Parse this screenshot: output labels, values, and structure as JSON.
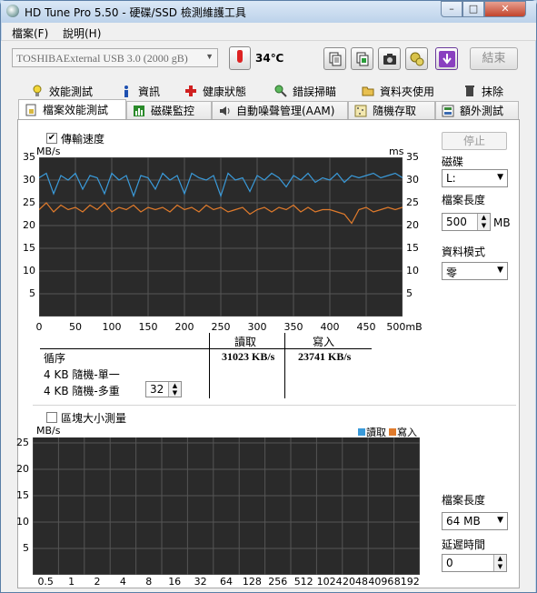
{
  "window": {
    "title": "HD Tune Pro 5.50 - 硬碟/SSD 檢測維護工具",
    "min": "–",
    "max": "□",
    "close": "✕"
  },
  "menu": [
    {
      "label": "檔案(F)"
    },
    {
      "label": "說明(H)"
    }
  ],
  "toolbar": {
    "drive": "TOSHIBAExternal USB 3.0 (2000 gB)",
    "temperature": "34℃",
    "exit_label": "結束",
    "icons": [
      "copy-text-icon",
      "copy-screenshot-icon",
      "camera-icon",
      "options-icon",
      "save-icon"
    ]
  },
  "tabs_row1": [
    {
      "label": "效能測試",
      "icon": "bulb-icon"
    },
    {
      "label": "資訊",
      "icon": "info-icon"
    },
    {
      "label": "健康狀態",
      "icon": "health-cross-icon"
    },
    {
      "label": "錯誤掃瞄",
      "icon": "magnifier-icon"
    },
    {
      "label": "資料夾使用",
      "icon": "folder-icon"
    },
    {
      "label": "抹除",
      "icon": "trash-icon"
    }
  ],
  "tabs_row2": [
    {
      "label": "檔案效能測試",
      "icon": "file-icon",
      "active": true
    },
    {
      "label": "磁碟監控",
      "icon": "monitor-icon"
    },
    {
      "label": "自動噪聲管理(AAM)",
      "icon": "speaker-icon"
    },
    {
      "label": "隨機存取",
      "icon": "random-icon"
    },
    {
      "label": "額外測試",
      "icon": "extra-icon"
    }
  ],
  "transfer": {
    "checkbox_label": "傳輸速度",
    "checked": true,
    "left_unit": "MB/s",
    "right_unit": "ms"
  },
  "side": {
    "stop_label": "停止",
    "disk_label": "磁碟",
    "disk_value": "L:",
    "file_length_label": "檔案長度",
    "file_length_value": "500",
    "file_length_unit": "MB",
    "data_pattern_label": "資料模式",
    "data_pattern_value": "零"
  },
  "results": {
    "col_read": "讀取",
    "col_write": "寫入",
    "rows": [
      {
        "label": "循序",
        "read": "31023 KB/s",
        "write": "23741 KB/s"
      },
      {
        "label": "4 KB 隨機-單一",
        "read": "",
        "write": ""
      },
      {
        "label": "4 KB 隨機-多重",
        "read": "",
        "write": "",
        "queue": "32"
      }
    ]
  },
  "block": {
    "checkbox_label": "區塊大小測量",
    "checked": false,
    "unit": "MB/s",
    "legend_read": "讀取",
    "legend_write": "寫入",
    "file_length_label": "檔案長度",
    "file_length_value": "64 MB",
    "delay_label": "延遲時間",
    "delay_value": "0"
  },
  "colors": {
    "read": "#3a9ad9",
    "write": "#e07b2c",
    "chart_bg": "#2a2a2a",
    "grid": "#555555"
  },
  "chart_data": [
    {
      "type": "line",
      "title": "",
      "xlabel": "",
      "ylabel": "MB/s",
      "x_unit": "MB",
      "xlim": [
        0,
        500
      ],
      "ylim": [
        0,
        35
      ],
      "xticks": [
        "0",
        "50",
        "100",
        "150",
        "200",
        "250",
        "300",
        "350",
        "400",
        "450",
        "500mB"
      ],
      "yticks_left": [
        "35",
        "30",
        "25",
        "20",
        "15",
        "10",
        "5"
      ],
      "yticks_right": [
        "35",
        "30",
        "25",
        "20",
        "15",
        "10",
        "5"
      ],
      "grid": true,
      "series": [
        {
          "name": "讀取",
          "x": [
            0,
            10,
            20,
            30,
            40,
            50,
            60,
            70,
            80,
            90,
            100,
            110,
            120,
            130,
            140,
            150,
            160,
            170,
            180,
            190,
            200,
            210,
            220,
            230,
            240,
            250,
            260,
            270,
            280,
            290,
            300,
            310,
            320,
            330,
            340,
            350,
            360,
            370,
            380,
            390,
            400,
            410,
            420,
            430,
            440,
            450,
            460,
            470,
            480,
            490,
            500
          ],
          "values": [
            30.5,
            31.5,
            27,
            31,
            30,
            31.5,
            28,
            31,
            30.5,
            27,
            31.5,
            30,
            31,
            26.5,
            31,
            30.5,
            28,
            31.5,
            30,
            31,
            27,
            31.5,
            30.5,
            30,
            31,
            26.5,
            31.5,
            30,
            30.5,
            27.5,
            31,
            30,
            31.5,
            30.5,
            28.5,
            31,
            30,
            31.5,
            29.5,
            30.5,
            30,
            31.5,
            29.5,
            31,
            30.5,
            31,
            31.5,
            30.5,
            31,
            31.5,
            30.5
          ]
        },
        {
          "name": "寫入",
          "x": [
            0,
            10,
            20,
            30,
            40,
            50,
            60,
            70,
            80,
            90,
            100,
            110,
            120,
            130,
            140,
            150,
            160,
            170,
            180,
            190,
            200,
            210,
            220,
            230,
            240,
            250,
            260,
            270,
            280,
            290,
            300,
            310,
            320,
            330,
            340,
            350,
            360,
            370,
            380,
            390,
            400,
            410,
            420,
            430,
            440,
            450,
            460,
            470,
            480,
            490,
            500
          ],
          "values": [
            23.5,
            25,
            23,
            24.5,
            23.5,
            24,
            23,
            24.5,
            23.5,
            25,
            23,
            24,
            23.5,
            24.5,
            23,
            24,
            23.5,
            24,
            23,
            24.5,
            23.5,
            24,
            23,
            24.5,
            23.5,
            24,
            23,
            23.5,
            24,
            22.5,
            23.5,
            24,
            23,
            24,
            23.5,
            24.5,
            23,
            24,
            23,
            23.5,
            23.5,
            23,
            22.5,
            20.5,
            23.5,
            24,
            23,
            23.5,
            24,
            23.5,
            24
          ]
        }
      ]
    },
    {
      "type": "bar",
      "title": "",
      "xlabel": "",
      "ylabel": "MB/s",
      "ylim": [
        0,
        25
      ],
      "yticks": [
        "25",
        "20",
        "15",
        "10",
        "5"
      ],
      "categories": [
        "0.5",
        "1",
        "2",
        "4",
        "8",
        "16",
        "32",
        "64",
        "128",
        "256",
        "512",
        "1024",
        "2048",
        "4096",
        "8192"
      ],
      "series": [
        {
          "name": "讀取",
          "values": []
        },
        {
          "name": "寫入",
          "values": []
        }
      ]
    }
  ]
}
